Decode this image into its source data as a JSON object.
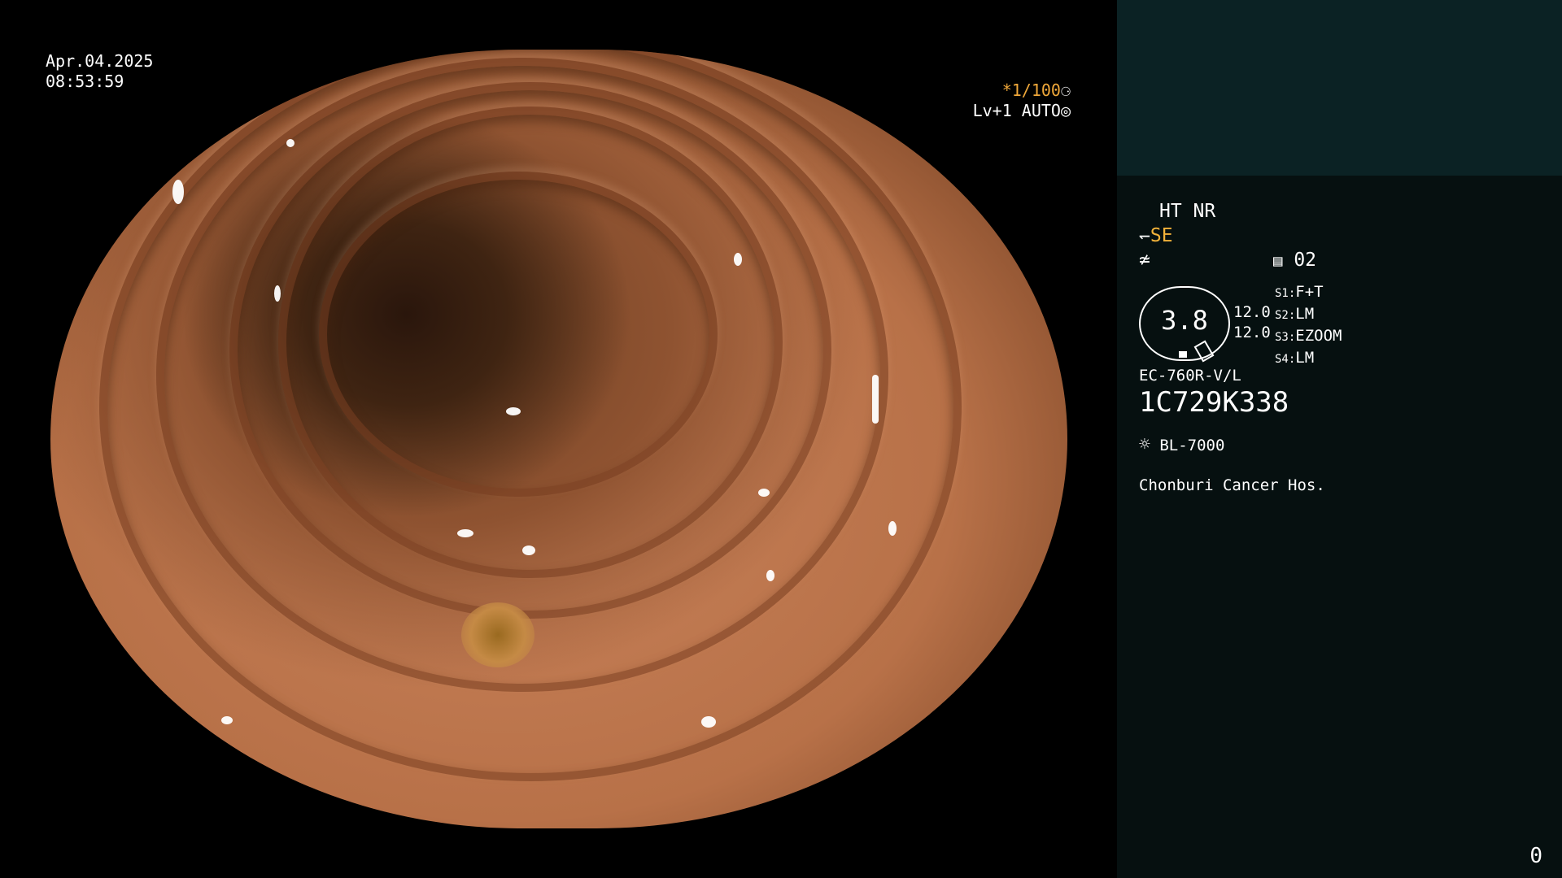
{
  "overlay": {
    "date": "Apr.04.2025",
    "time": "08:53:59",
    "shutter": "*1/100",
    "shutter_icon": "aperture-icon",
    "iris": "Lv+1 AUTO",
    "iris_icon": "iris-icon"
  },
  "panel": {
    "ht_nr": "HT NR",
    "se": "SE",
    "se_icon": "structure-enhance-icon",
    "af_icon": "af-icon",
    "file_icon": "file-icon",
    "file_no": "02",
    "zoom": "3.8",
    "range1": "12.0",
    "range2": "12.0",
    "switches": [
      {
        "key": "S1:",
        "val": "F+T"
      },
      {
        "key": "S2:",
        "val": "LM"
      },
      {
        "key": "S3:",
        "val": "EZOOM"
      },
      {
        "key": "S4:",
        "val": "LM"
      }
    ],
    "model": "EC-760R-V/L",
    "serial": "1C729K338",
    "light_source": "BL-7000",
    "light_icon": "light-source-icon",
    "hospital": "Chonburi Cancer Hos.",
    "counter": "0"
  },
  "colors": {
    "accent": "#f0a83a",
    "top_panel": "#0b2224",
    "info_panel": "#061010"
  }
}
